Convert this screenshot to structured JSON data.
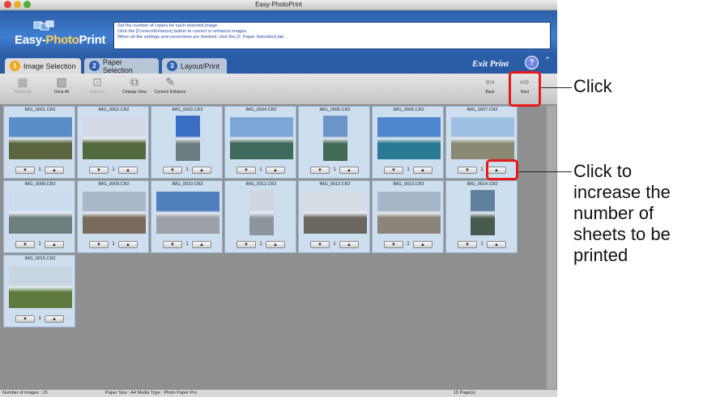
{
  "window": {
    "title": "Easy-PhotoPrint",
    "logo_text_1": "Easy-",
    "logo_text_2": "Photo",
    "logo_text_3": "Print",
    "instructions": [
      "Set the number of copies for each selected image.",
      "Click the [Correct/Enhance] button to correct or enhance images.",
      "When all the settings and corrections are finished, click the [2. Paper Selection] tab."
    ]
  },
  "tabs": [
    {
      "num": "1",
      "label": "Image Selection"
    },
    {
      "num": "2",
      "label": "Paper Selection"
    },
    {
      "num": "3",
      "label": "Layout/Print"
    }
  ],
  "exit_label": "Exit Print",
  "help_label": "?",
  "toolbar": {
    "select_all": "Select All",
    "clear_all": "Clear All",
    "zoom_in": "Zoom in",
    "change_view": "Change View",
    "correct_enhance": "Correct/ Enhance",
    "back": "Back",
    "next": "Next"
  },
  "images": [
    {
      "name": "IMG_0001.CR2",
      "count": "1",
      "orient": "landscape",
      "sky": "#5a8ec8",
      "ground": "#5b6640"
    },
    {
      "name": "IMG_0002.CR2",
      "count": "1",
      "orient": "landscape",
      "sky": "#d4dbe6",
      "ground": "#556a3c"
    },
    {
      "name": "IMG_0003.CR2",
      "count": "1",
      "orient": "portrait",
      "sky": "#3a6ec4",
      "ground": "#6a7e80"
    },
    {
      "name": "IMG_0004.CR2",
      "count": "1",
      "orient": "landscape",
      "sky": "#7ca6d6",
      "ground": "#3d6a5a"
    },
    {
      "name": "IMG_0005.CR2",
      "count": "1",
      "orient": "portrait",
      "sky": "#6b95c9",
      "ground": "#3f6b54"
    },
    {
      "name": "IMG_0006.CR2",
      "count": "1",
      "orient": "landscape",
      "sky": "#4e86cc",
      "ground": "#2a7a94"
    },
    {
      "name": "IMG_0007.CR2",
      "count": "1",
      "orient": "landscape",
      "sky": "#9ec0e2",
      "ground": "#8a8a72"
    },
    {
      "name": "IMG_0008.CR2",
      "count": "1",
      "orient": "landscape",
      "sky": "#cbdcee",
      "ground": "#6f7f80"
    },
    {
      "name": "IMG_0009.CR2",
      "count": "1",
      "orient": "landscape",
      "sky": "#a8b8c8",
      "ground": "#7a6a5c"
    },
    {
      "name": "IMG_0010.CR2",
      "count": "1",
      "orient": "landscape",
      "sky": "#4e7fbd",
      "ground": "#9aa0a6"
    },
    {
      "name": "IMG_0011.CR2",
      "count": "1",
      "orient": "portrait",
      "sky": "#cfd8e2",
      "ground": "#8c949c"
    },
    {
      "name": "IMG_0012.CR2",
      "count": "1",
      "orient": "landscape",
      "sky": "#d6dde4",
      "ground": "#6c6660"
    },
    {
      "name": "IMG_0013.CR2",
      "count": "1",
      "orient": "landscape",
      "sky": "#a4b6c8",
      "ground": "#8c8478"
    },
    {
      "name": "IMG_0014.CR2",
      "count": "1",
      "orient": "portrait",
      "sky": "#5f7f9c",
      "ground": "#4a5a4e"
    },
    {
      "name": "IMG_0015.CR2",
      "count": "1",
      "orient": "landscape",
      "sky": "#c8d6e2",
      "ground": "#5f7a3e"
    }
  ],
  "arrows": {
    "down": "▼",
    "up": "▲"
  },
  "status": {
    "images": "Number of images : 15",
    "paper": "Paper Size : A4 Media Type : Photo Paper Pro",
    "pages": "15 Page(s)"
  },
  "callouts": {
    "next": "Click",
    "increase": [
      "Click to",
      "increase the",
      "number of",
      "sheets to be",
      "printed"
    ]
  },
  "colors": {
    "highlight": "#e81818",
    "header_blue": "#2b5ea8"
  }
}
